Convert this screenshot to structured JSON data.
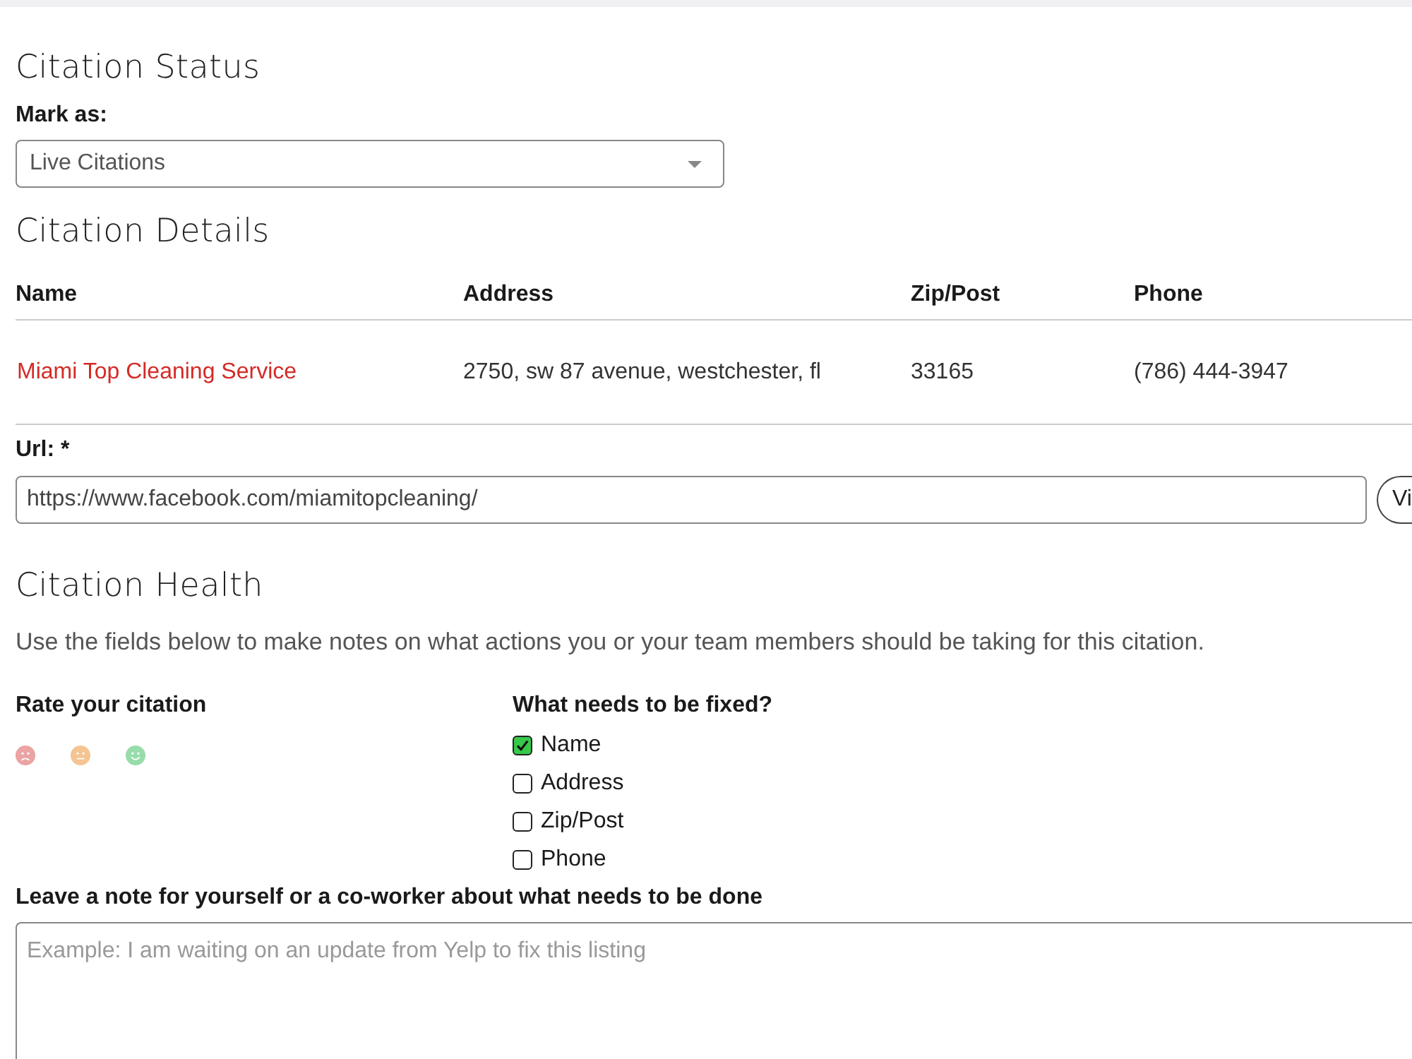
{
  "citation_status": {
    "heading": "Citation Status",
    "label": "Mark as:",
    "dropdown": {
      "value": "Live Citations"
    }
  },
  "citation_details": {
    "heading": "Citation Details",
    "table": {
      "columns": [
        "Name",
        "Address",
        "Zip/Post",
        "Phone"
      ],
      "rows": [
        {
          "cells": [
            {
              "kind": "link",
              "text": "Miami Top Cleaning Service"
            },
            {
              "kind": "text",
              "text": "2750, sw 87 avenue, westchester, fl"
            },
            {
              "kind": "text",
              "text": "33165"
            },
            {
              "kind": "text",
              "text": "(786) 444-3947"
            }
          ]
        }
      ]
    },
    "url": {
      "label": "Url: *",
      "value": "https://www.facebook.com/miamitopcleaning/",
      "button": "Vi"
    }
  },
  "citation_health": {
    "heading": "Citation Health",
    "description": "Use the fields below to make notes on what actions you or your team members should be taking for this citation.",
    "rating": {
      "label": "Rate your citation",
      "options": [
        {
          "kind": "sad",
          "color": "#eba3a3",
          "selected": false
        },
        {
          "kind": "neutral",
          "color": "#f4c592",
          "selected": false
        },
        {
          "kind": "happy",
          "color": "#98dcaa",
          "selected": false
        }
      ]
    },
    "fixes": {
      "label": "What needs to be fixed?",
      "items": [
        {
          "label": "Name",
          "checked": true
        },
        {
          "label": "Address",
          "checked": false
        },
        {
          "label": "Zip/Post",
          "checked": false
        },
        {
          "label": "Phone",
          "checked": false
        }
      ]
    },
    "note": {
      "label": "Leave a note for yourself or a co-worker about what needs to be done",
      "placeholder": "Example: I am waiting on an update from Yelp to fix this listing"
    }
  }
}
